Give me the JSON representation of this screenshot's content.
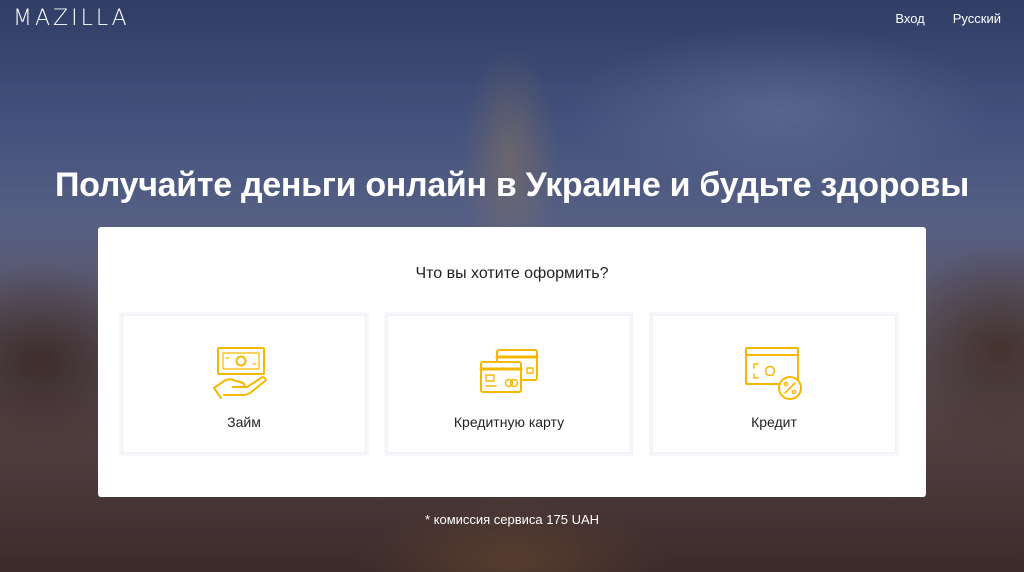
{
  "header": {
    "logo": "MAZILLA",
    "nav": {
      "login": "Вход",
      "language": "Русский"
    }
  },
  "hero": {
    "title": "Получайте деньги онлайн в Украине и будьте здоровы"
  },
  "card": {
    "question": "Что вы хотите оформить?",
    "options": [
      {
        "label": "Займ",
        "icon": "cash-hand-icon"
      },
      {
        "label": "Кредитную карту",
        "icon": "credit-cards-icon"
      },
      {
        "label": "Кредит",
        "icon": "percent-bill-icon"
      }
    ]
  },
  "footer_note": "* комиссия сервиса 175 UAH",
  "colors": {
    "accent": "#f5b800",
    "card_bg": "#ffffff",
    "text_dark": "#222222",
    "text_light": "#ffffff"
  }
}
